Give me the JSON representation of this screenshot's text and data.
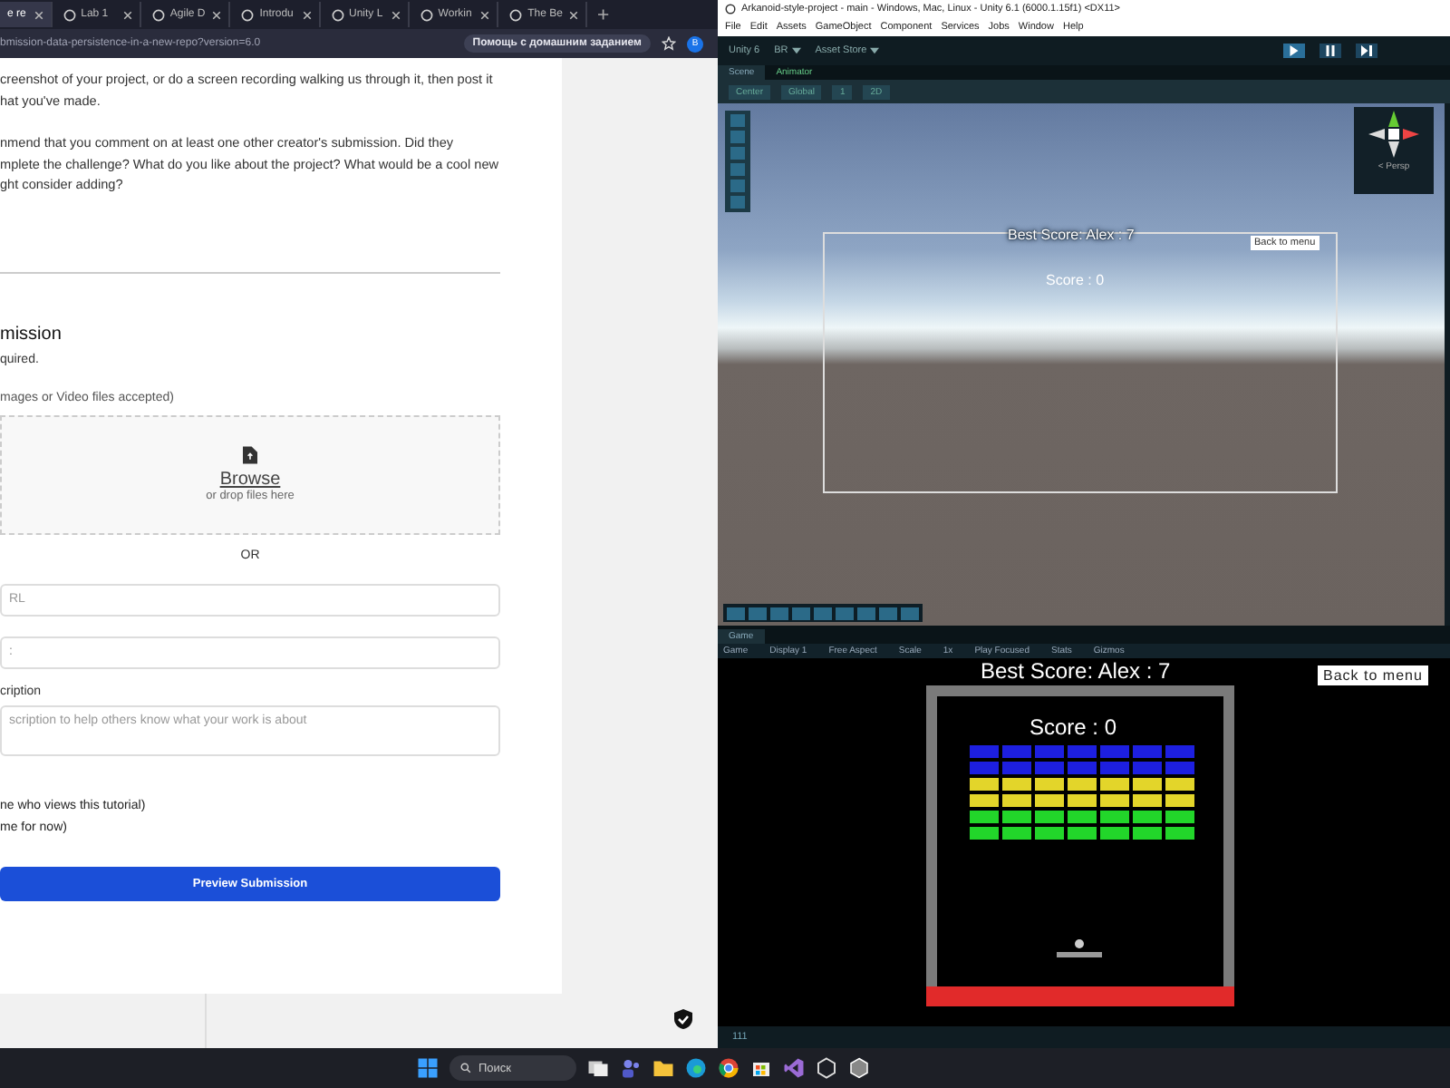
{
  "browser": {
    "tabs": [
      {
        "label": "e re",
        "selected": true
      },
      {
        "label": "Lab 1",
        "selected": false
      },
      {
        "label": "Agile D",
        "selected": false
      },
      {
        "label": "Introdu",
        "selected": false
      },
      {
        "label": "Unity L",
        "selected": false
      },
      {
        "label": "Workin",
        "selected": false
      },
      {
        "label": "The Be",
        "selected": false
      }
    ],
    "url": "bmission-data-persistence-in-a-new-repo?version=6.0",
    "assist_chip": "Помощь с домашним заданием",
    "profile_initial": "B",
    "page": {
      "paragraphs": [
        [
          "creenshot of your project, or do a screen recording walking us through it, then post it",
          "hat you've made."
        ],
        [
          "nmend that you comment on at least one other creator's submission. Did they",
          "mplete the challenge? What do you like about the project? What would be a cool new",
          "ght consider adding?"
        ]
      ],
      "heading": "mission",
      "required_note": "quired.",
      "upload_label": "mages or Video files accepted)",
      "browse": "Browse",
      "drop_hint": "or drop files here",
      "or": "OR",
      "url_field": {
        "placeholder": "RL"
      },
      "title_field": {
        "placeholder": ":"
      },
      "description_label": "cription",
      "description_field": {
        "placeholder": "scription to help others know what your work is about"
      },
      "visibility_options": [
        "ne who views this tutorial)",
        "me for now)"
      ],
      "submit": "Preview Submission"
    }
  },
  "unity": {
    "title": "Arkanoid-style-project - main - Windows, Mac, Linux - Unity 6.1 (6000.1.15f1) <DX11>",
    "menu": [
      "File",
      "Edit",
      "Assets",
      "GameObject",
      "Component",
      "Services",
      "Jobs",
      "Window",
      "Help"
    ],
    "toolbar": {
      "version": "Unity 6",
      "account": "BR",
      "asset_store": "Asset Store"
    },
    "scene_tabs": [
      {
        "label": "Scene",
        "selected": true
      },
      {
        "label": "Animator",
        "selected": false
      }
    ],
    "scene_toolbar": [
      "Center",
      "Global",
      "1",
      "2D"
    ],
    "gizmo_label": "< Persp",
    "scene_ui": {
      "best_score": "Best Score: Alex : 7",
      "score": "Score : 0",
      "back": "Back to menu"
    },
    "game_tab": "Game",
    "game_toolbar": [
      "Game",
      "Display 1",
      "Free Aspect",
      "Scale",
      "1x",
      "Play Focused",
      "Stats",
      "Gizmos"
    ],
    "game": {
      "best_score": "Best Score: Alex : 7",
      "back": "Back to menu",
      "score": "Score : 0",
      "brick_rows": [
        {
          "color": "#1d1fe0"
        },
        {
          "color": "#1d1fe0"
        },
        {
          "color": "#e3d52a"
        },
        {
          "color": "#e3d52a"
        },
        {
          "color": "#22d62a"
        },
        {
          "color": "#22d62a"
        }
      ]
    },
    "status": "111"
  },
  "taskbar": {
    "search": "Поиск"
  }
}
